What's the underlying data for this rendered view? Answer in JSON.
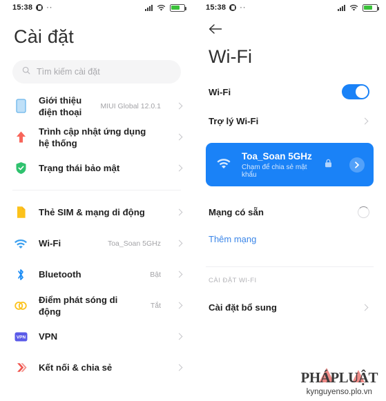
{
  "status_bar": {
    "time": "15:38",
    "icons": [
      "alarm-icon",
      "ellipsis-icon",
      "signal-icon",
      "wifi-icon",
      "battery-icon"
    ]
  },
  "settings_panel": {
    "title": "Cài đặt",
    "search": {
      "placeholder": "Tìm kiếm cài đặt",
      "icon": "search-icon"
    },
    "groups": [
      {
        "items": [
          {
            "icon": "phone-icon",
            "label": "Giới thiệu điện thoại",
            "value": "MIUI Global 12.0.1",
            "color": "#9fd0f5"
          },
          {
            "icon": "up-arrow-icon",
            "label": "Trình cập nhật ứng dụng hệ thống",
            "value": "",
            "color": "#f7655a"
          },
          {
            "icon": "shield-check-icon",
            "label": "Trạng thái bảo mật",
            "value": "",
            "color": "#2fc26e"
          }
        ]
      },
      {
        "items": [
          {
            "icon": "sim-card-icon",
            "label": "Thẻ SIM & mạng di động",
            "value": "",
            "color": "#fcc21b"
          },
          {
            "icon": "wifi-icon",
            "label": "Wi-Fi",
            "value": "Toa_Soan 5GHz",
            "color": "#3ba0f0"
          },
          {
            "icon": "bluetooth-icon",
            "label": "Bluetooth",
            "value": "Bật",
            "color": "#1a8cf5"
          },
          {
            "icon": "hotspot-icon",
            "label": "Điểm phát sóng di động",
            "value": "Tắt",
            "color": "#fcc21b"
          },
          {
            "icon": "vpn-icon",
            "label": "VPN",
            "value": "",
            "color": "#5a5ae8"
          },
          {
            "icon": "share-connect-icon",
            "label": "Kết nối & chia sẻ",
            "value": "",
            "color": "#f0564f"
          }
        ]
      }
    ]
  },
  "wifi_panel": {
    "back_icon": "back-arrow-icon",
    "title": "Wi-Fi",
    "toggle_row": {
      "label": "Wi-Fi",
      "enabled": true
    },
    "assistant_row": {
      "label": "Trợ lý Wi-Fi"
    },
    "connected_network": {
      "name": "Toa_Soan 5GHz",
      "subtitle": "Chạm để chia sẻ mật khẩu",
      "wifi_icon": "wifi-icon",
      "lock_icon": "lock-icon",
      "arrow_icon": "chevron-right-icon",
      "accent": "#1a82f7"
    },
    "available_networks": {
      "label": "Mạng có sẵn",
      "status_icon": "loading-spinner"
    },
    "add_network": {
      "label": "Thêm mạng",
      "color": "#3b86e8"
    },
    "section_header": "CÀI ĐẶT WI-FI",
    "additional_settings": {
      "label": "Cài đặt bổ sung"
    }
  },
  "watermark": {
    "logo": "PHÁPLUẬT",
    "url": "kynguyenso.plo.vn"
  }
}
